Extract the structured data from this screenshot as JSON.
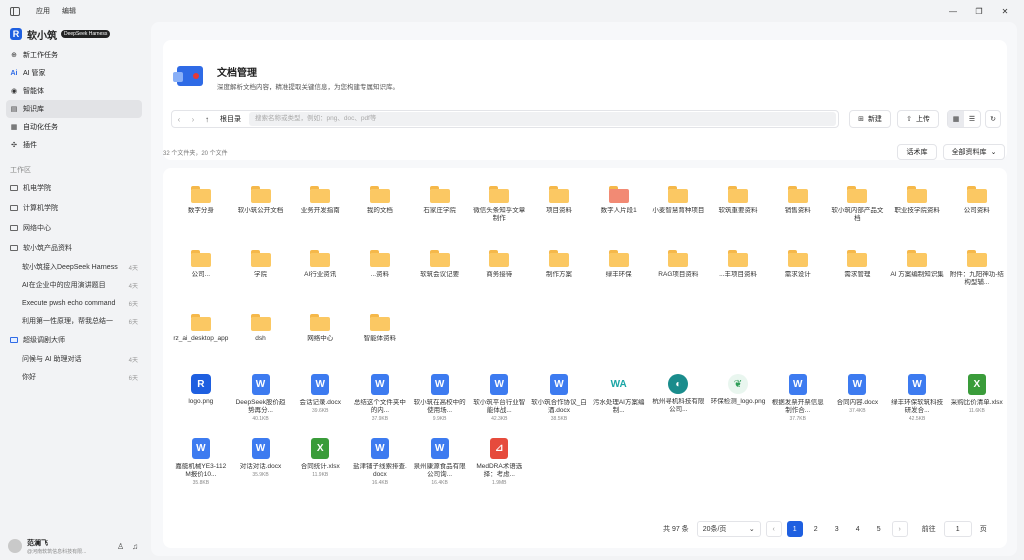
{
  "titlebar": {
    "menu": [
      "应用",
      "编辑"
    ],
    "controls": [
      "—",
      "❐",
      "✕"
    ]
  },
  "sidebar": {
    "brand": {
      "logo": "R",
      "name": "软小筑",
      "tag": "DeepSeek Harness"
    },
    "nav": [
      {
        "label": "新工作任务",
        "icon": "plus-circle-icon"
      },
      {
        "label": "AI 管家",
        "icon": "ai-icon"
      },
      {
        "label": "智能体",
        "icon": "agent-icon"
      },
      {
        "label": "知识库",
        "icon": "book-icon",
        "active": true
      },
      {
        "label": "自动化任务",
        "icon": "calendar-icon"
      },
      {
        "label": "插件",
        "icon": "plugin-icon"
      }
    ],
    "workspace_label": "工作区",
    "workspaces": [
      "机电学院",
      "计算机学院",
      "网络中心",
      "软小筑产品资料"
    ],
    "tasks": [
      {
        "label": "软小筑接入DeepSeek Harness",
        "time": "4天"
      },
      {
        "label": "AI在企业中的应用演讲题目",
        "time": "4天"
      },
      {
        "label": "Execute pwsh echo command",
        "time": "6天"
      },
      {
        "label": "利用第一性原理，帮我总结一",
        "time": "6天"
      }
    ],
    "group2": "超级调剧大师",
    "tasks2": [
      {
        "label": "问候与 AI 助理对话",
        "time": "4天"
      },
      {
        "label": "你好",
        "time": "6天"
      }
    ],
    "user": {
      "name": "范澜飞",
      "company": "@河南软筑信息科技有限..."
    }
  },
  "header": {
    "title": "文档管理",
    "desc": "深度解析文档内容，精准提取关键信息，为您构建专属知识库。"
  },
  "toolbar": {
    "crumb": "根目录",
    "search_placeholder": "搜索名称或类型，例如：png、doc、pdf等",
    "new_label": "新建",
    "upload_label": "上传"
  },
  "summary": "32 个文件夹，20 个文件",
  "lib_buttons": [
    "话术库",
    "全部资料库"
  ],
  "items": [
    {
      "type": "folder",
      "label": "数字分身"
    },
    {
      "type": "folder",
      "label": "软小筑公开文档"
    },
    {
      "type": "folder",
      "label": "业务开发指南"
    },
    {
      "type": "folder",
      "label": "我的文档"
    },
    {
      "type": "folder",
      "label": "石家庄学院"
    },
    {
      "type": "folder",
      "label": "微信头条知乎文章制作"
    },
    {
      "type": "folder",
      "label": "项目资料"
    },
    {
      "type": "folder-red",
      "label": "数字人片段1"
    },
    {
      "type": "folder",
      "label": "小麦智慧育种项目"
    },
    {
      "type": "folder",
      "label": "软筑重要资料"
    },
    {
      "type": "folder",
      "label": "销售资料"
    },
    {
      "type": "folder",
      "label": "软小筑内部产品文档"
    },
    {
      "type": "folder",
      "label": "职业技学院资料"
    },
    {
      "type": "folder",
      "label": "公司资料"
    },
    {
      "type": "folder",
      "label": "公司..."
    },
    {
      "type": "folder",
      "label": "学院"
    },
    {
      "type": "folder",
      "label": "AI行业资讯"
    },
    {
      "type": "folder",
      "label": "...资料"
    },
    {
      "type": "folder",
      "label": "软筑会议记要"
    },
    {
      "type": "folder",
      "label": "商务接待"
    },
    {
      "type": "folder",
      "label": "制作方案"
    },
    {
      "type": "folder",
      "label": "绿丰环保"
    },
    {
      "type": "folder",
      "label": "RAG项目资料"
    },
    {
      "type": "folder",
      "label": "...丰项目资料"
    },
    {
      "type": "folder",
      "label": "需求设计"
    },
    {
      "type": "folder",
      "label": "需求管理"
    },
    {
      "type": "folder",
      "label": "AI 方案编制知识集"
    },
    {
      "type": "folder",
      "label": "附件：九阳神功-结构型辅..."
    },
    {
      "type": "folder",
      "label": "rz_ai_desktop_app"
    },
    {
      "type": "folder",
      "label": "dsh"
    },
    {
      "type": "folder",
      "label": "网络中心"
    },
    {
      "type": "folder",
      "label": "智能体资料"
    },
    {
      "type": "spacer"
    },
    {
      "type": "spacer"
    },
    {
      "type": "spacer"
    },
    {
      "type": "spacer"
    },
    {
      "type": "spacer"
    },
    {
      "type": "spacer"
    },
    {
      "type": "spacer"
    },
    {
      "type": "spacer"
    },
    {
      "type": "spacer"
    },
    {
      "type": "spacer"
    },
    {
      "type": "img",
      "glyph": "R",
      "label": "logo.png"
    },
    {
      "type": "word",
      "glyph": "W",
      "label": "DeepSeek股价趋势再分...",
      "size": "40.1KB"
    },
    {
      "type": "word",
      "glyph": "W",
      "label": "会话记录.docx",
      "size": "39.6KB"
    },
    {
      "type": "word",
      "glyph": "W",
      "label": "总结这个文件夹中的内...",
      "size": "37.9KB"
    },
    {
      "type": "word",
      "glyph": "W",
      "label": "软小筑在高校中的使用场...",
      "size": "9.9KB"
    },
    {
      "type": "word",
      "glyph": "W",
      "label": "软小筑平台行业智能体战...",
      "size": "42.3KB"
    },
    {
      "type": "word",
      "glyph": "W",
      "label": "软小筑合作协议_白酒.docx",
      "size": "38.5KB"
    },
    {
      "type": "wa",
      "glyph": "WA",
      "label": "污水处理AI方案编制..."
    },
    {
      "type": "hz",
      "glyph": "◐",
      "label": "杭州寻机科技有限公司..."
    },
    {
      "type": "hb",
      "glyph": "❦",
      "label": "环保检测_logo.png"
    },
    {
      "type": "word",
      "glyph": "W",
      "label": "根据发票开票信息制作合...",
      "size": "37.7KB"
    },
    {
      "type": "word",
      "glyph": "W",
      "label": "合同内容.docx",
      "size": "37.4KB"
    },
    {
      "type": "word",
      "glyph": "W",
      "label": "绿丰环保软筑科技研发合...",
      "size": "42.5KB"
    },
    {
      "type": "xls",
      "glyph": "X",
      "label": "采购比价清单.xlsx",
      "size": "11.6KB"
    },
    {
      "type": "word",
      "glyph": "W",
      "label": "嘉艇机械YE3-112M报价10...",
      "size": "35.8KB"
    },
    {
      "type": "word",
      "glyph": "W",
      "label": "对话对话.docx",
      "size": "35.9KB"
    },
    {
      "type": "xls",
      "glyph": "X",
      "label": "合同统计.xlsx",
      "size": "11.9KB"
    },
    {
      "type": "word",
      "glyph": "W",
      "label": "盐津铺子线索排查.docx",
      "size": "16.4KB"
    },
    {
      "type": "word",
      "glyph": "W",
      "label": "泉州康源食品有限公司询...",
      "size": "16.4KB"
    },
    {
      "type": "pdf",
      "glyph": "⊿",
      "label": "MedDRA术语选择：考虑...",
      "size": "1.9MB"
    }
  ],
  "pager": {
    "total": "共 97 条",
    "page_size": "20条/页",
    "pages": [
      "1",
      "2",
      "3",
      "4",
      "5"
    ],
    "current": "1",
    "goto_label": "前往",
    "goto_value": "1",
    "page_unit": "页"
  }
}
